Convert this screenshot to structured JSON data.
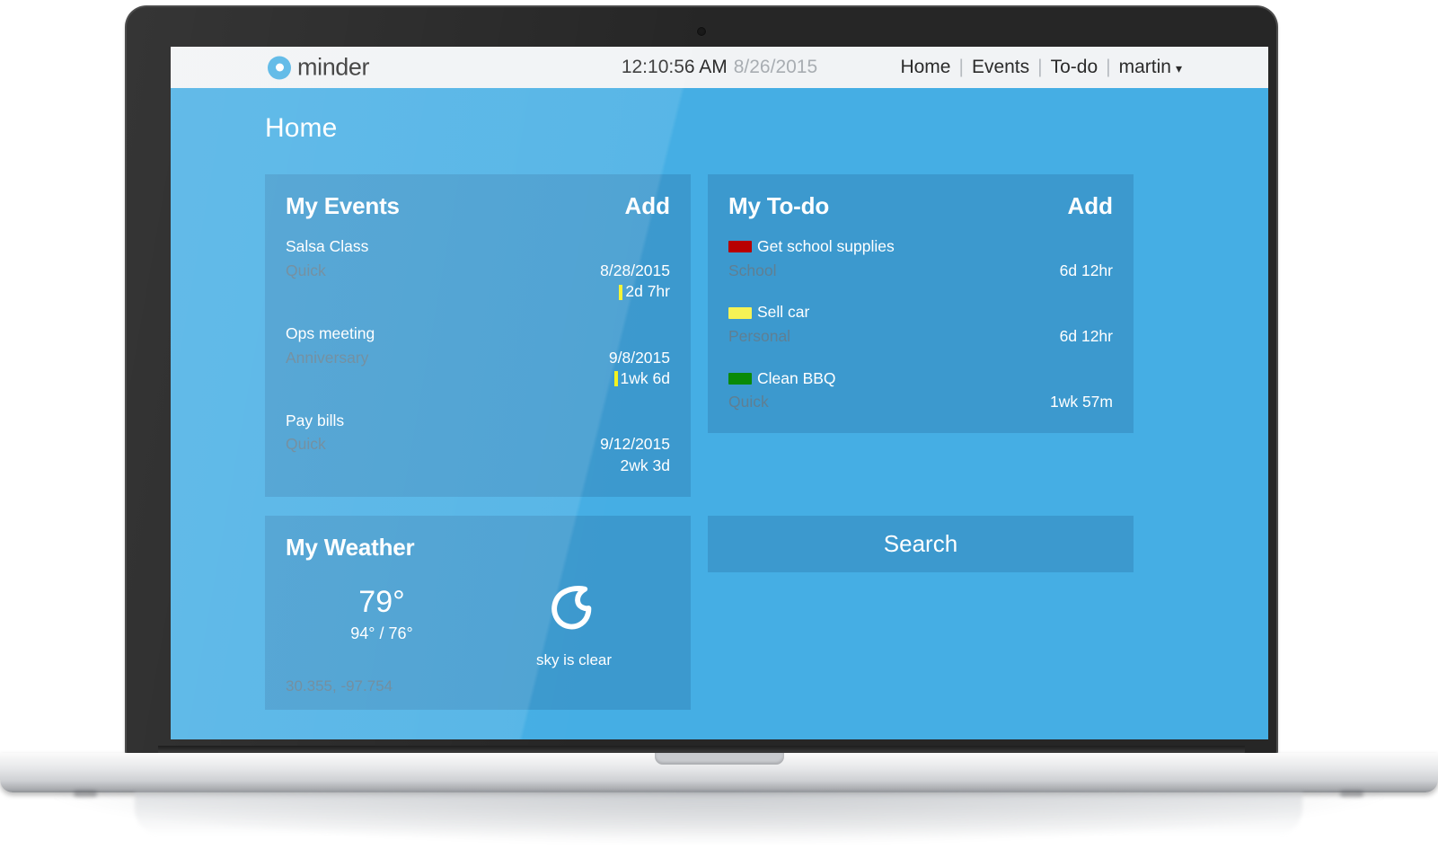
{
  "app": {
    "brand_name": "minder",
    "brand_icon": "ring-dot-logo"
  },
  "topbar": {
    "clock_time": "12:10:56 AM",
    "clock_date": "8/26/2015",
    "nav": [
      {
        "label": "Home"
      },
      {
        "label": "Events"
      },
      {
        "label": "To-do"
      },
      {
        "label": "martin"
      }
    ],
    "separator": "|",
    "user_caret": "▾"
  },
  "page": {
    "title": "Home"
  },
  "events_card": {
    "title": "My Events",
    "add_label": "Add",
    "items": [
      {
        "name": "Salsa Class",
        "category": "Quick",
        "date": "8/28/2015",
        "remaining": "2d 7hr",
        "has_bar": true
      },
      {
        "name": "Ops meeting",
        "category": "Anniversary",
        "date": "9/8/2015",
        "remaining": "1wk 6d",
        "has_bar": true
      },
      {
        "name": "Pay bills",
        "category": "Quick",
        "date": "9/12/2015",
        "remaining": "2wk 3d",
        "has_bar": false
      }
    ]
  },
  "todo_card": {
    "title": "My To-do",
    "add_label": "Add",
    "items": [
      {
        "name": "Get school supplies",
        "category": "School",
        "remaining": "6d 12hr",
        "swatch_color": "#B80000"
      },
      {
        "name": "Sell car",
        "category": "Personal",
        "remaining": "6d 12hr",
        "swatch_color": "#F5F355"
      },
      {
        "name": "Clean BBQ",
        "category": "Quick",
        "remaining": "1wk 57m",
        "swatch_color": "#0A8A08"
      }
    ]
  },
  "weather_card": {
    "title": "My Weather",
    "temp_current": "79°",
    "temp_range": "94° / 76°",
    "condition_icon": "crescent-moon-icon",
    "condition_text": "sky is clear",
    "coordinates": "30.355, -97.754"
  },
  "search_button": {
    "label": "Search"
  },
  "colors": {
    "page_background": "#45AEE4",
    "card_background": "#3C99CE",
    "topbar_background": "#F1F3F5",
    "brand_blue": "#49B0E4",
    "muted_text": "#5F7F93",
    "remaining_bar": "#F3F31E"
  }
}
